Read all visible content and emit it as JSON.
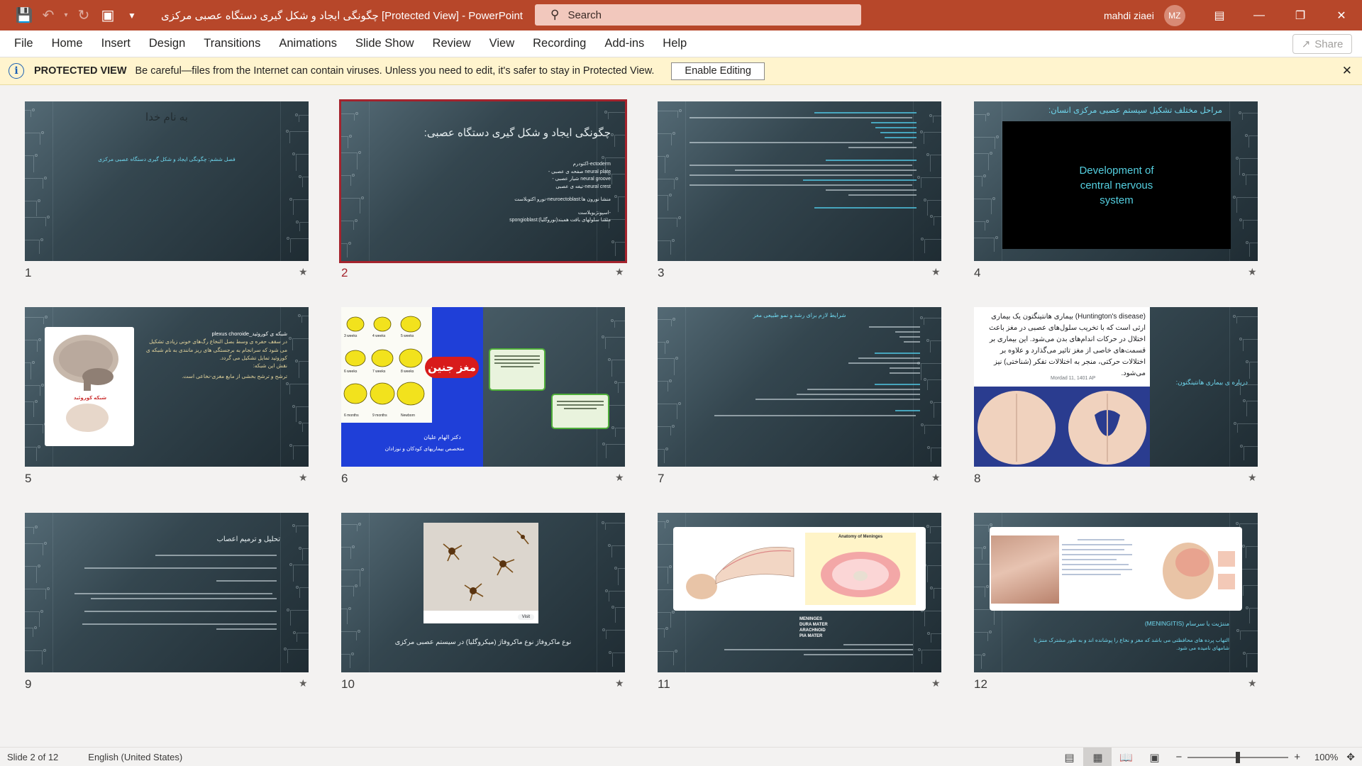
{
  "window": {
    "title": "چگونگی ایجاد و شکل گیری دستگاه عصبی مرکزی [Protected View]  -  PowerPoint",
    "search_placeholder": "Search",
    "user_name": "mahdi ziaei",
    "user_initials": "MZ"
  },
  "menu": {
    "items": [
      "File",
      "Home",
      "Insert",
      "Design",
      "Transitions",
      "Animations",
      "Slide Show",
      "Review",
      "View",
      "Recording",
      "Add-ins",
      "Help"
    ],
    "share_label": "Share"
  },
  "protected_view": {
    "title": "PROTECTED VIEW",
    "message": "Be careful—files from the Internet can contain viruses. Unless you need to edit, it's safer to stay in Protected View.",
    "button": "Enable Editing"
  },
  "slides": [
    {
      "number": "1",
      "title": "به نام خدا",
      "body": "فصل ششم: چگونگی ایجاد و شکل گیری دستگاه عصبی مرکزی"
    },
    {
      "number": "2",
      "title": "چگونگی ایجاد و شکل گیری دستگاه عصبی:",
      "lines": [
        "ectoderm-اکتودرم",
        "neural plate صفحه ی عصبی -",
        "neural groove شیار عصبی -",
        "neural crest-تیغه ی عصبی",
        "منشا نورون ها:neuroectoblast-نورو اکتوبلاست",
        "-اسپونژیوبلاست",
        "منشا سلولهای بافت همبند(نوروگلیا):spongioblast"
      ]
    },
    {
      "number": "3"
    },
    {
      "number": "4",
      "title": "مراحل مختلف تشکیل سیستم عصبی مرکزی انسان:",
      "video_text": "Development of central nervous system"
    },
    {
      "number": "5",
      "bullet": "شبکه ی کوروئید_plexus choroide",
      "lines": [
        "در سقف حفره ی وسط بصل النخاع رگ‌های خونی زیادی تشکیل می شود که سرانجام به برجستگی های ریز مانندی به نام شبکه ی کوروئید تمایل تشکیل می گردد.",
        "نقش این شبکه:",
        "ترشح و ترشح بخشی از مایع مغزی-نخاعی است."
      ],
      "img_caption": "شبکه کوروئید"
    },
    {
      "number": "6",
      "badge": "مغز جنین",
      "credit_name": "دکتر الهام علیان",
      "credit_role": "متخصص بیماریهای کودکان و نوزادان",
      "weeks": [
        "3 weeks",
        "4 weeks",
        "5 weeks",
        "6 weeks",
        "7 weeks",
        "8 weeks",
        "6 months",
        "9 months",
        "Newborn"
      ]
    },
    {
      "number": "7",
      "title": "شرایط لازم برای رشد و نمو طبیعی مغز"
    },
    {
      "number": "8",
      "heading": "(Huntington's disease) بیماری هانتینگتون",
      "lines": [
        "یک بیماری ارثی است که با تخریب سلول‌های عصبی در مغز باعث اختلال در حرکات اندام‌های بدن می‌شود. این بیماری بر قسمت‌های خاصی از مغز تاثیر می‌گذارد و علاوه بر اختلالات حرکتی، منجر به اختلالات تفکر (شناختی) نیز می‌شود."
      ],
      "date": "Mordad 11, 1401 AP",
      "side_title": "درباره ی بیماری هانتینگتون:"
    },
    {
      "number": "9",
      "title": "تحلیل و ترمیم اعصاب"
    },
    {
      "number": "10",
      "caption": "نوع ماکروفاژ نوع ماکروفاژ (میکروگلیا) در سیستم عصبی مرکزی",
      "visit": "Visit"
    },
    {
      "number": "11",
      "terms": [
        "MENINGES",
        "DURA MATER",
        "ARACHNOID",
        "PIA MATER"
      ],
      "img_title": "Anatomy of Meninges"
    },
    {
      "number": "12",
      "title": "مننژیت یا سرسام (MENINGITIS)",
      "body": "التهاب پرده های محافظتی می باشد که مغز و نخاع را پوشانده اند و به طور مشترک مننژ یا شامهای نامیده می شود."
    }
  ],
  "status": {
    "slide_info": "Slide 2 of 12",
    "language": "English (United States)",
    "zoom": "100%"
  }
}
